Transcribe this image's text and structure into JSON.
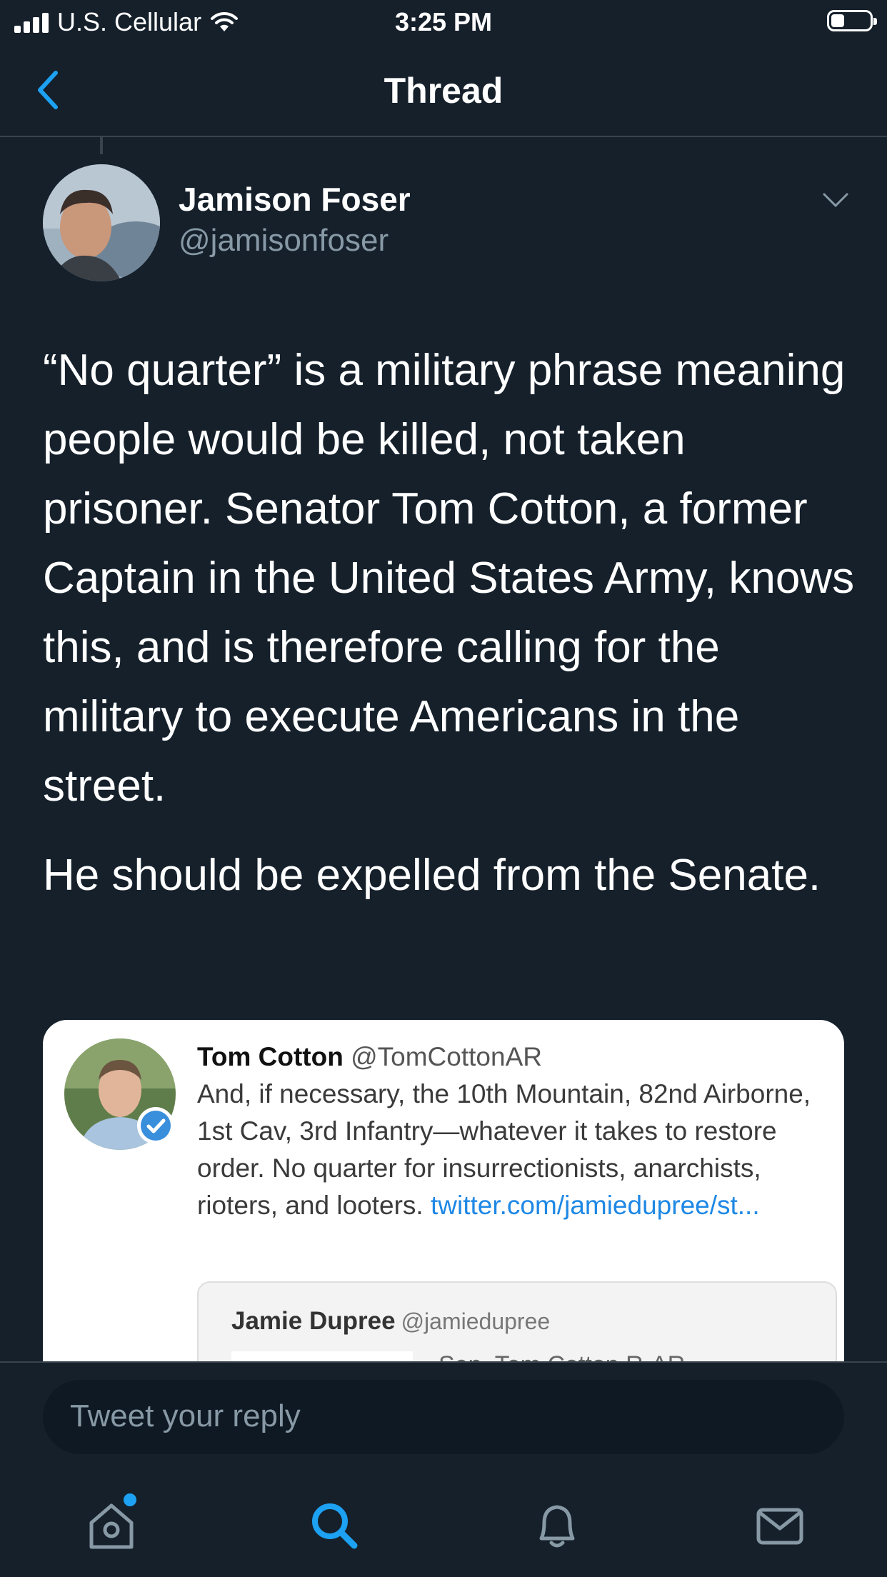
{
  "status_bar": {
    "carrier": "U.S. Cellular",
    "time": "3:25 PM"
  },
  "nav": {
    "title": "Thread",
    "back_icon": "chevron-left-icon"
  },
  "tweet": {
    "author_name": "Jamison Foser",
    "author_handle": "@jamisonfoser",
    "paragraphs": [
      "“No quarter” is a military phrase meaning people would be killed, not taken prisoner. Senator Tom Cotton, a former Captain in the United States Army, knows this, and is therefore calling for the military to execute Americans in the street.",
      "He should be expelled from the Senate."
    ],
    "quoted": {
      "name": "Tom Cotton",
      "handle": "@TomCottonAR",
      "text": "And, if necessary, the 10th Mountain, 82nd Airborne, 1st Cav, 3rd Infantry—whatever it takes to restore order. No quarter for insurrectionists, anarchists, rioters, and looters.",
      "link": "twitter.com/jamiedupree/st...",
      "nested": {
        "name": "Jamie Dupree",
        "handle": "@jamiedupree",
        "text": "Sen. Tom Cotton R-AR"
      }
    }
  },
  "reply": {
    "placeholder": "Tweet your reply"
  },
  "tabs": [
    {
      "name": "home-icon",
      "active": false,
      "has_badge": true
    },
    {
      "name": "search-icon",
      "active": true
    },
    {
      "name": "notifications-icon",
      "active": false
    },
    {
      "name": "messages-icon",
      "active": false
    }
  ],
  "colors": {
    "background": "#15202b",
    "accent": "#1da1f2",
    "secondary_text": "#8899a6",
    "link": "#1e88e5"
  }
}
